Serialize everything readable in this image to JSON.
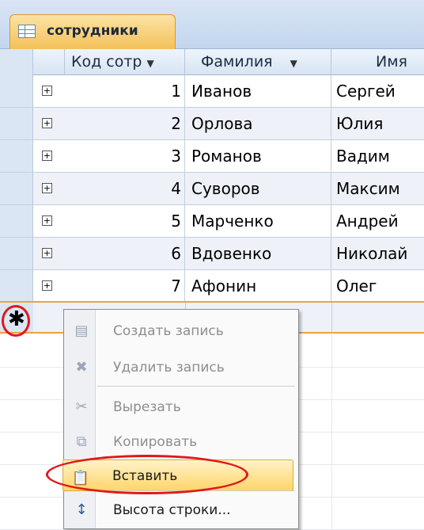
{
  "tab": {
    "label": "сотрудники"
  },
  "columns": [
    "Код сотр",
    "Фамилия",
    "Имя"
  ],
  "rows": [
    {
      "id": "1",
      "last": "Иванов",
      "first": "Сергей"
    },
    {
      "id": "2",
      "last": "Орлова",
      "first": "Юлия"
    },
    {
      "id": "3",
      "last": "Романов",
      "first": "Вадим"
    },
    {
      "id": "4",
      "last": "Суворов",
      "first": "Максим"
    },
    {
      "id": "5",
      "last": "Марченко",
      "first": "Андрей"
    },
    {
      "id": "6",
      "last": "Вдовенко",
      "first": "Николай"
    },
    {
      "id": "7",
      "last": "Афонин",
      "first": "Олег"
    }
  ],
  "new_record_symbol": "✱",
  "expand_symbol": "+",
  "menu": {
    "items": [
      {
        "label": "Создать запись",
        "enabled": false,
        "icon": "new-record-icon"
      },
      {
        "label": "Удалить запись",
        "enabled": false,
        "icon": "delete-record-icon"
      },
      {
        "label": "Вырезать",
        "enabled": false,
        "icon": "scissors-icon"
      },
      {
        "label": "Копировать",
        "enabled": false,
        "icon": "copy-icon"
      },
      {
        "label": "Вставить",
        "enabled": true,
        "icon": "paste-icon"
      },
      {
        "label": "Высота строки...",
        "enabled": true,
        "icon": "row-height-icon"
      }
    ]
  },
  "colors": {
    "highlight": "#e01818",
    "tab": "#f4c15a",
    "header": "#d7e4f3"
  }
}
